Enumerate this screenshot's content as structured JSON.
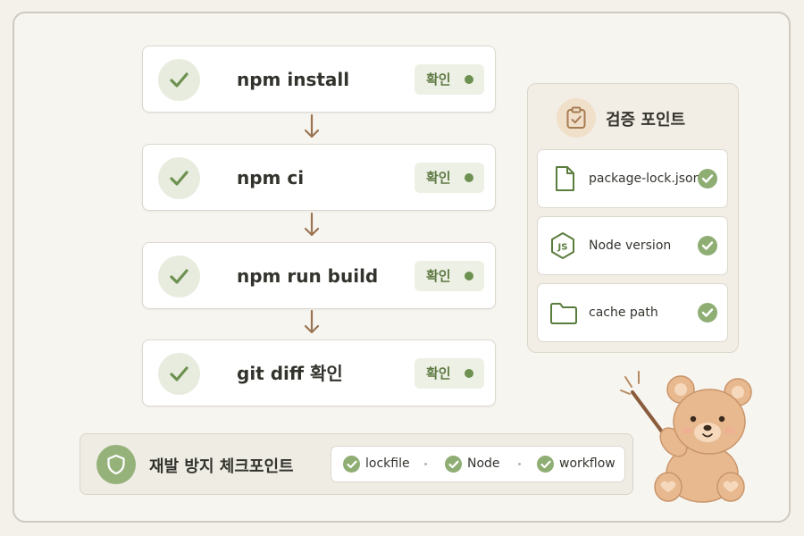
{
  "steps": [
    {
      "label": "npm install",
      "badge": "확인"
    },
    {
      "label": "npm ci",
      "badge": "확인"
    },
    {
      "label": "npm run build",
      "badge": "확인"
    },
    {
      "label": "git diff 확인",
      "badge": "확인"
    }
  ],
  "verification": {
    "title": "검증 포인트",
    "items": [
      {
        "label": "package-lock.json",
        "icon": "file-icon"
      },
      {
        "label": "Node version",
        "icon": "nodejs-icon"
      },
      {
        "label": "cache path",
        "icon": "folder-icon"
      }
    ]
  },
  "checkpoints": {
    "title": "재발 방지 체크포인트",
    "items": [
      "lockfile",
      "Node",
      "workflow"
    ]
  },
  "colors": {
    "accent_green": "#6d9150",
    "check_green": "#8fae74",
    "arrow_brown": "#9a7552",
    "bear_tan": "#e8b98f"
  }
}
